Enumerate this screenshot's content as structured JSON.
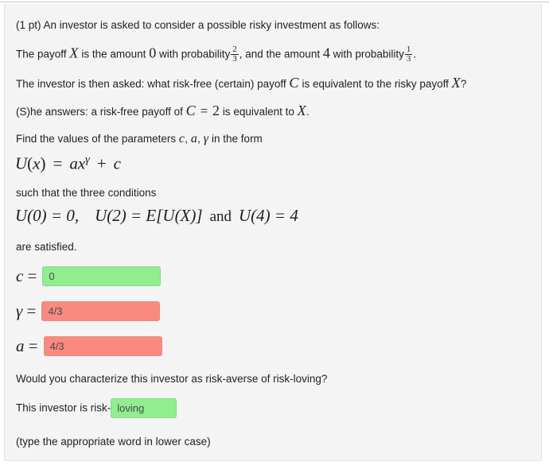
{
  "problem": {
    "points_label": "(1 pt)",
    "intro": "An investor is asked to consider a possible risky investment as follows:",
    "payoff_line": {
      "seg1": "The payoff",
      "var_x": "X",
      "seg2": "is the amount",
      "amount_0": "0",
      "seg3": "with probability",
      "prob1_num": "2",
      "prob1_den": "3",
      "seg4": ", and the amount",
      "amount_4": "4",
      "seg5": "with probability",
      "prob2_num": "1",
      "prob2_den": "3",
      "seg6": "."
    },
    "question_line": {
      "seg1": "The investor is then asked: what risk-free (certain) payoff",
      "var_c": "C",
      "seg2": "is equivalent to the risky payoff",
      "var_x": "X",
      "seg3": "?"
    },
    "answer_line": {
      "seg1": "(S)he answers: a risk-free payoff of",
      "var_c": "C",
      "equals": "=",
      "value_2": "2",
      "seg2": "is equivalent to",
      "var_x": "X",
      "seg3": "."
    },
    "find_line": {
      "seg1": "Find the values of the parameters",
      "param_c": "c",
      "comma1": ",",
      "param_a": "a",
      "comma2": ",",
      "param_gamma": "γ",
      "seg2": "in the form"
    },
    "utility_equation": {
      "lhs_u": "U",
      "lhs_paren_open": "(",
      "lhs_x": "x",
      "lhs_paren_close": ")",
      "equals": "=",
      "rhs_a": "a",
      "rhs_x": "x",
      "rhs_gamma": "γ",
      "plus": "+",
      "rhs_c": "c"
    },
    "conditions_intro": "such that the three conditions",
    "conditions_equation": {
      "cond1": "U(0) = 0,",
      "cond2": "U(2) = E[U(X)]",
      "and_text": "and",
      "cond3": "U(4) = 4"
    },
    "satisfied_text": "are satisfied."
  },
  "answers": [
    {
      "name": "c",
      "label_var": "c",
      "label_eq": "=",
      "value": "0",
      "placeholder": "",
      "status": "correct"
    },
    {
      "name": "gamma",
      "label_var": "γ",
      "label_eq": "=",
      "value": "4/3",
      "placeholder": "",
      "status": "incorrect"
    },
    {
      "name": "a",
      "label_var": "a",
      "label_eq": "=",
      "value": "4/3",
      "placeholder": "",
      "status": "incorrect"
    }
  ],
  "closing": {
    "characterize_question": "Would you characterize this investor as risk-averse of risk-loving?",
    "investor_prefix": "This investor is risk-",
    "investor_answer": {
      "value": "loving",
      "placeholder": "",
      "status": "correct"
    },
    "hint": "(type the appropriate word in lower case)"
  },
  "colors": {
    "correct_bg": "#90ee90",
    "incorrect_bg": "#fa8a80",
    "panel_bg": "#f4f4f4",
    "panel_border": "#e2e2e2",
    "text": "#222222"
  }
}
